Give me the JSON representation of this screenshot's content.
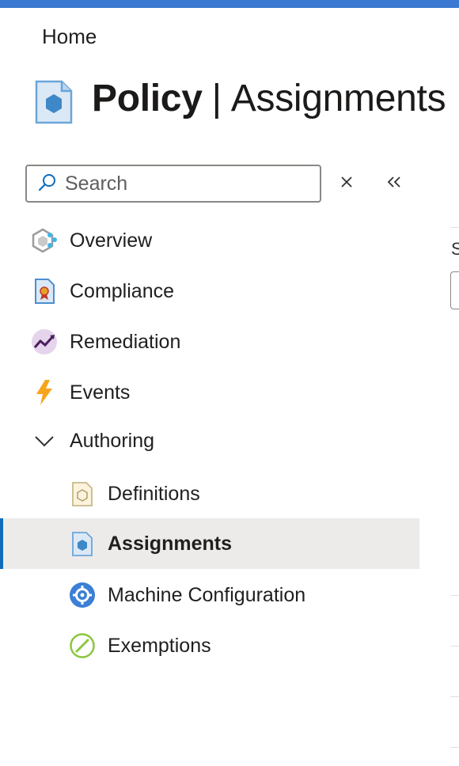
{
  "colors": {
    "accent": "#3a78d1",
    "selected_bg": "#edebe9",
    "selected_indicator": "#0f6cbd"
  },
  "breadcrumb": {
    "home": "Home"
  },
  "header": {
    "title_bold": "Policy",
    "separator": "|",
    "title_rest": "Assignments",
    "icon": "policy-assignment-icon"
  },
  "search": {
    "placeholder": "Search",
    "value": "",
    "icon": "search-icon",
    "clear_icon": "close-icon",
    "collapse_icon": "double-chevron-left-icon"
  },
  "nav": {
    "items": [
      {
        "label": "Overview",
        "icon": "overview-icon"
      },
      {
        "label": "Compliance",
        "icon": "compliance-icon"
      },
      {
        "label": "Remediation",
        "icon": "remediation-icon"
      },
      {
        "label": "Events",
        "icon": "events-lightning-icon"
      },
      {
        "label": "Authoring",
        "icon": "chevron-down-icon",
        "expanded": true
      }
    ],
    "authoring_children": [
      {
        "label": "Definitions",
        "icon": "definitions-icon"
      },
      {
        "label": "Assignments",
        "icon": "assignments-icon",
        "selected": true
      },
      {
        "label": "Machine Configuration",
        "icon": "machine-configuration-icon"
      },
      {
        "label": "Exemptions",
        "icon": "exemptions-icon"
      }
    ]
  },
  "right_panel": {
    "partial_label": "S"
  }
}
